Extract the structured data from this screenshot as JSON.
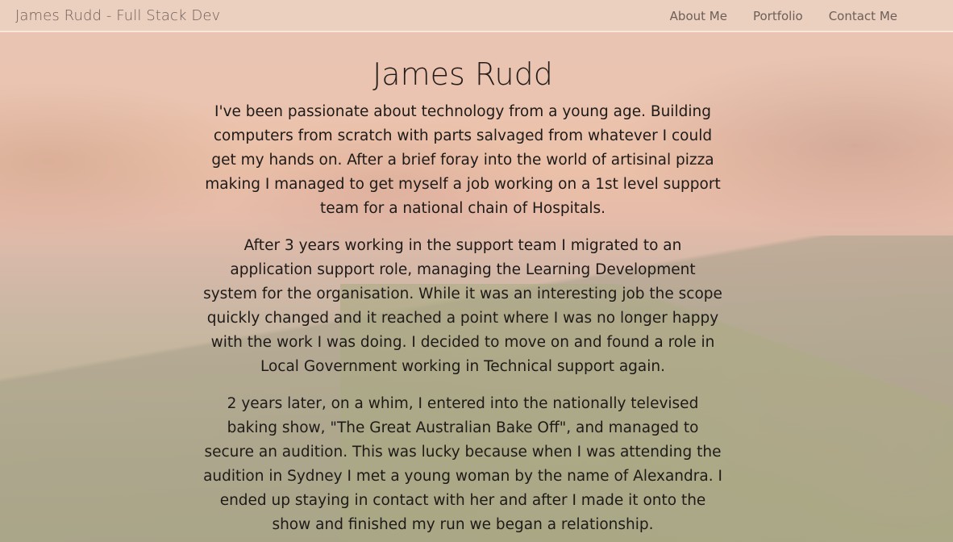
{
  "navbar": {
    "brand": "James Rudd - Full Stack Dev",
    "links": [
      "About Me",
      "Portfolio",
      "Contact Me"
    ]
  },
  "about": {
    "heading": "James Rudd",
    "paragraphs": [
      "I've been passionate about technology from a young age. Building computers from scratch with parts salvaged from whatever I could get my hands on. After a brief foray into the world of artisinal pizza making I managed to get myself a job working on a 1st level support team for a national chain of Hospitals.",
      "After 3 years working in the support team I migrated to an application support role, managing the Learning Development system for the organisation. While it was an interesting job the scope quickly changed and it reached a point where I was no longer happy with the work I was doing. I decided to move on and found a role in Local Government working in Technical support again.",
      "2 years later, on a whim, I entered into the nationally televised baking show, \"The Great Australian Bake Off\", and managed to secure an audition. This was lucky because when I was attending the audition in Sydney I met a young woman by the name of Alexandra. I ended up staying in contact with her and after I made it onto the show and finished my run we began a relationship."
    ]
  }
}
